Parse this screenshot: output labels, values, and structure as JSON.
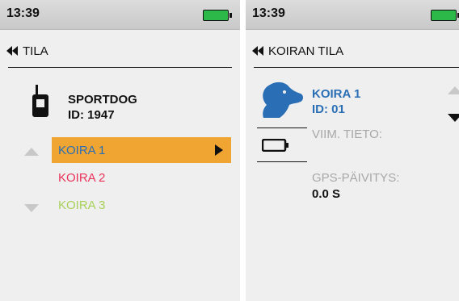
{
  "colors": {
    "selected_bg": "#f0a431",
    "dog1": "#2a6fb5",
    "dog2": "#e8325a",
    "dog3": "#a6d15a",
    "battery_green": "#2db84a",
    "muted_gray": "#a8a8a8"
  },
  "left_screen": {
    "status": {
      "time": "13:39",
      "battery_icon": "battery-full-icon"
    },
    "header": {
      "back_icon": "double-chevron-left-icon",
      "title": "TILA"
    },
    "device": {
      "icon": "handheld-device-icon",
      "name": "SPORTDOG",
      "id": "ID: 1947"
    },
    "dogs": [
      {
        "label": "KOIRA 1",
        "color": "#2a6fb5",
        "selected": true
      },
      {
        "label": "KOIRA 2",
        "color": "#e8325a",
        "selected": false
      },
      {
        "label": "KOIRA 3",
        "color": "#a6d15a",
        "selected": false
      }
    ],
    "scroll_icons": [
      "triangle-up-icon",
      "triangle-down-icon"
    ],
    "select_arrow": "triangle-right-icon"
  },
  "right_screen": {
    "status": {
      "time": "13:39",
      "battery_icon": "battery-full-icon"
    },
    "header": {
      "back_icon": "double-chevron-left-icon",
      "title": "KOIRAN TILA"
    },
    "dog": {
      "icon": "dog-head-icon",
      "name": "KOIRA 1",
      "id": "ID: 01"
    },
    "collar_battery_icon": "battery-empty-icon",
    "last_info_label": "VIIM. TIETO:",
    "gps_label": "GPS-PÄIVITYS:",
    "gps_value": "0.0 S"
  }
}
